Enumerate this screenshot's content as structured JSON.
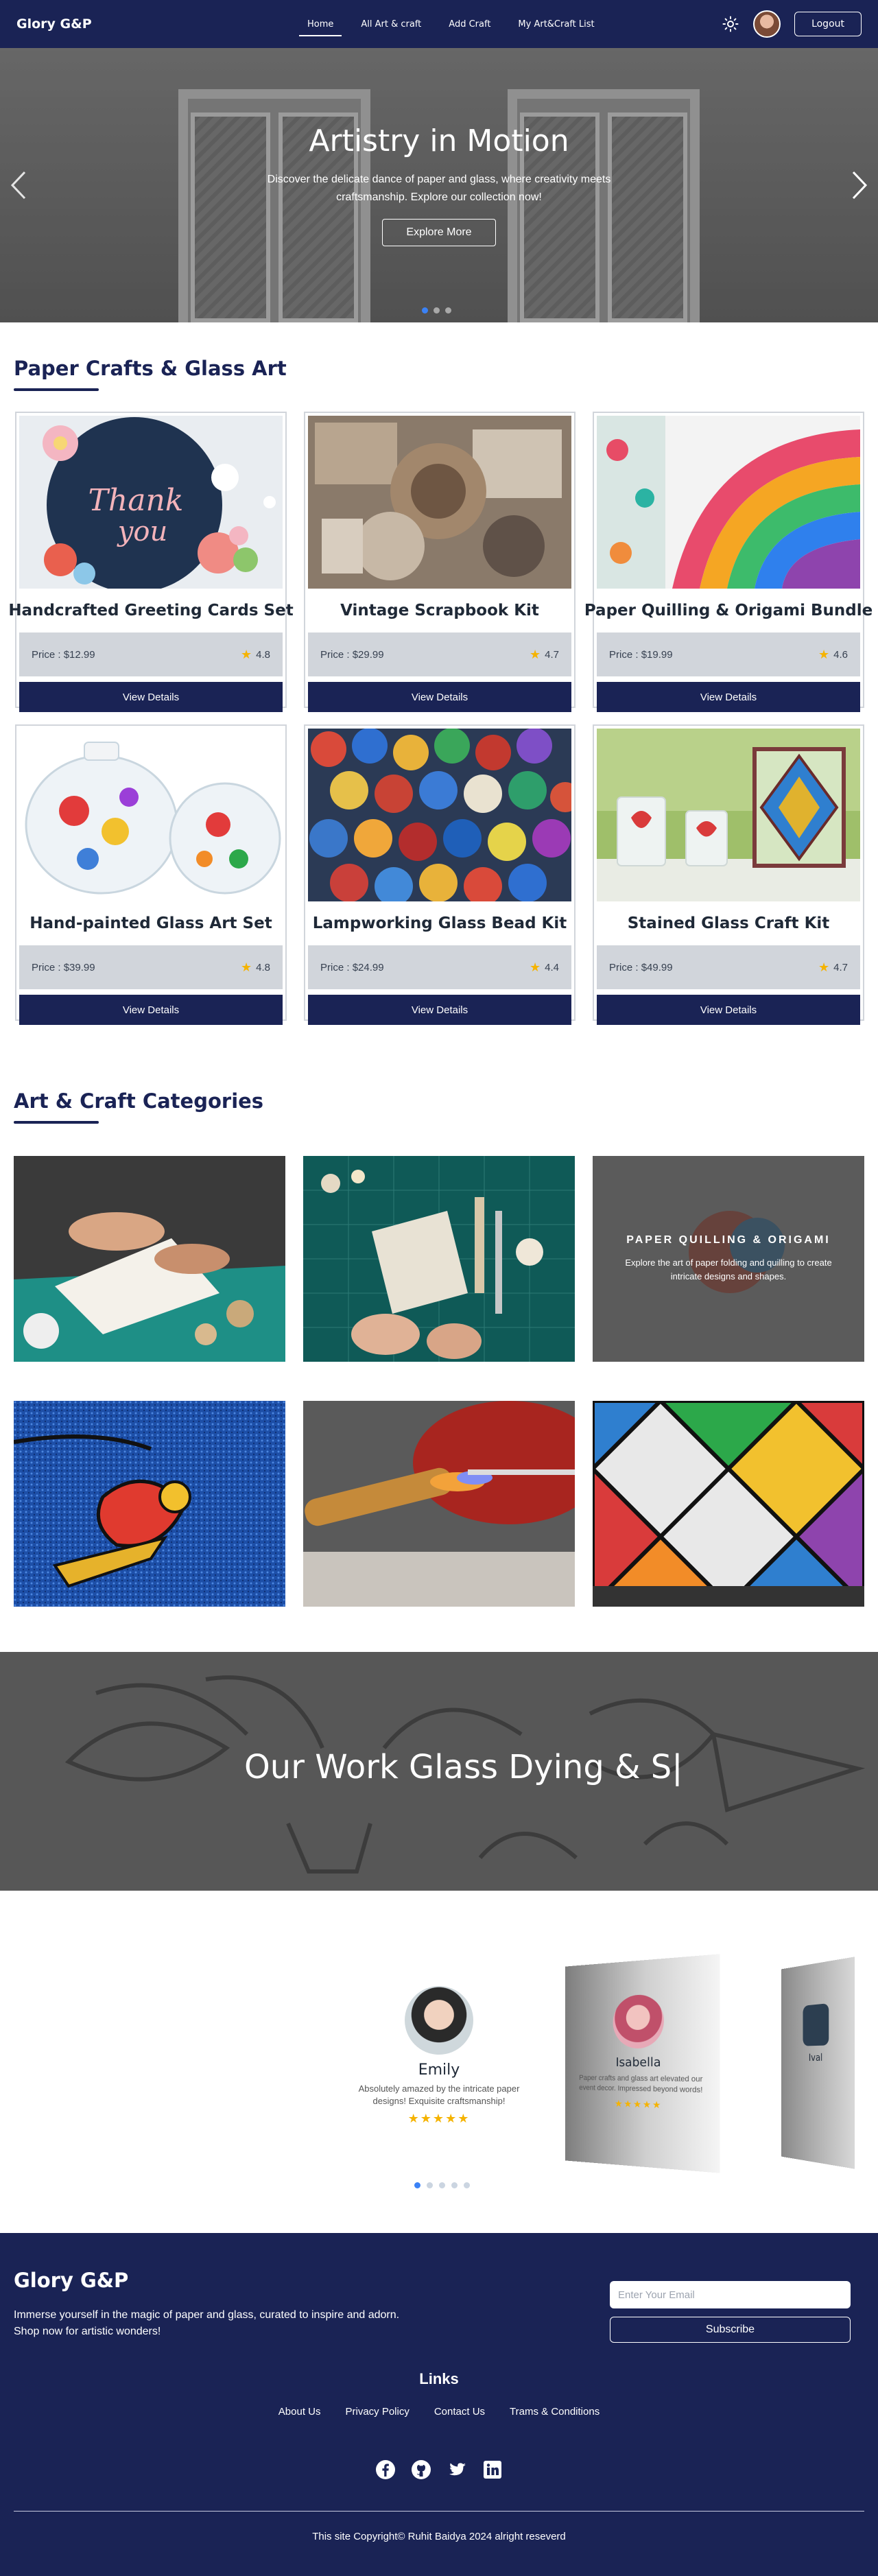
{
  "nav": {
    "brand": "Glory G&P",
    "links": [
      "Home",
      "All Art & craft",
      "Add Craft",
      "My Art&Craft List"
    ],
    "theme_icon": "sun-icon",
    "logout": "Logout"
  },
  "hero": {
    "title": "Artistry in Motion",
    "subtitle": "Discover the delicate dance of paper and glass, where creativity meets craftsmanship. Explore our collection now!",
    "button": "Explore More",
    "slide_count": 3,
    "active_slide": 1
  },
  "products": {
    "title": "Paper Crafts & Glass Art",
    "price_prefix": "Price : ",
    "details_label": "View Details",
    "items": [
      {
        "name": "Handcrafted Greeting Cards Set",
        "price": "$12.99",
        "rating": "4.8"
      },
      {
        "name": "Vintage Scrapbook Kit",
        "price": "$29.99",
        "rating": "4.7"
      },
      {
        "name": "Paper Quilling & Origami Bundle",
        "price": "$19.99",
        "rating": "4.6"
      },
      {
        "name": "Hand-painted Glass Art Set",
        "price": "$39.99",
        "rating": "4.8"
      },
      {
        "name": "Lampworking Glass Bead Kit",
        "price": "$24.99",
        "rating": "4.4"
      },
      {
        "name": "Stained Glass Craft Kit",
        "price": "$49.99",
        "rating": "4.7"
      }
    ]
  },
  "categories": {
    "title": "Art & Craft Categories",
    "featured_title": "PAPER QUILLING & ORIGAMI",
    "featured_desc": "Explore the art of paper folding and quilling to create intricate designs and shapes."
  },
  "banner": {
    "text": "Our Work Glass Dying & S|"
  },
  "testimonials": {
    "items": [
      {
        "name": "Emily",
        "text": "Absolutely amazed by the intricate paper designs! Exquisite craftsmanship!",
        "stars": "★★★★★"
      },
      {
        "name": "Isabella",
        "text": "Paper crafts and glass art elevated our event decor. Impressed beyond words!",
        "stars": "★★★★★"
      },
      {
        "name": "Ival",
        "text": "",
        "stars": ""
      }
    ],
    "dot_count": 5,
    "active_dot": 1
  },
  "footer": {
    "brand": "Glory G&P",
    "description": "Immerse yourself in the magic of paper and glass, curated to inspire and adorn. Shop now for artistic wonders!",
    "email_placeholder": "Enter Your Email",
    "subscribe": "Subscribe",
    "links_title": "Links",
    "links": [
      "About Us",
      "Privacy Policy",
      "Contact Us",
      "Trams & Conditions"
    ],
    "social": [
      "facebook-icon",
      "github-icon",
      "twitter-icon",
      "linkedin-icon"
    ],
    "copyright": "This site Copyright© Ruhit Baidya 2024 alright reseverd"
  },
  "colors": {
    "primary": "#1a2355",
    "star": "#f5b301",
    "accent": "#3b82f6"
  }
}
